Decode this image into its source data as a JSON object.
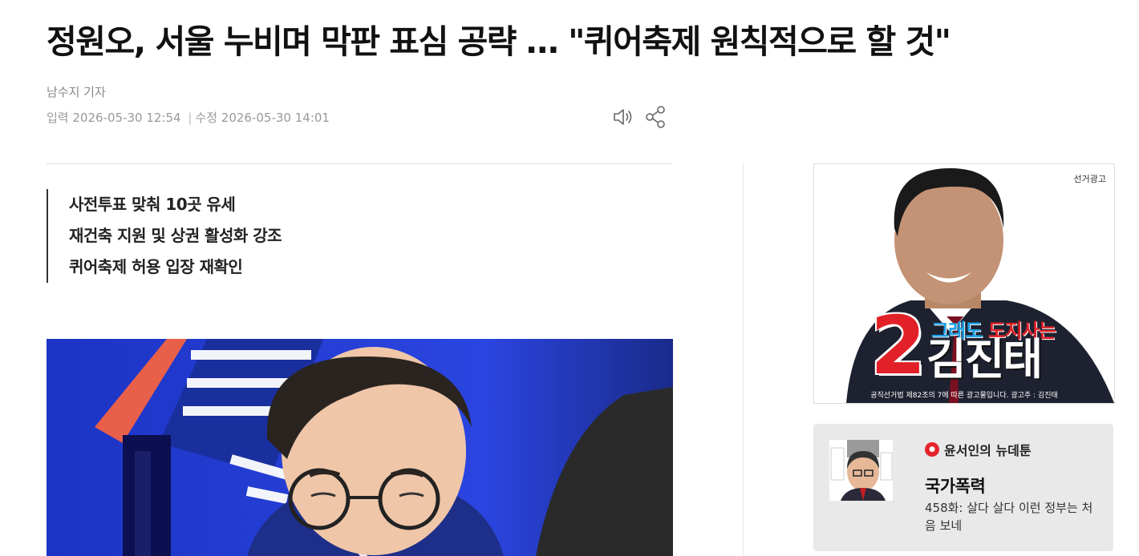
{
  "article": {
    "headline": "정원오, 서울 누비며 막판 표심 공략 … \"퀴어축제 원칙적으로 할 것\"",
    "reporter": "남수지 기자",
    "input_label": "입력",
    "input_date": "2026-05-30 12:54",
    "separator": "|",
    "update_label": "수정",
    "update_date": "2026-05-30 14:01",
    "subheadings": [
      "사전투표 맞춰 10곳 유세",
      "재건축 지원 및 상권 활성화 강조",
      "퀴어축제 허용 입장 재확인"
    ]
  },
  "tools": {
    "tts_icon": "speaker-icon",
    "share_icon": "share-icon"
  },
  "ad": {
    "label": "선거광고",
    "number": "2",
    "slogan_part1": "그래도",
    "slogan_part2": "도지사는",
    "name": "김진태",
    "footer": "공직선거법 제82조의 7에 따른 광고물입니다. 광고주 : 김진태",
    "colors": {
      "number": "#e12127",
      "slogan_blue": "#1aa0e8",
      "background_blue": "#1f35c8"
    }
  },
  "webtoon": {
    "brand": "윤서인의 뉴데툰",
    "title": "국가폭력",
    "description": "458화: 살다 살다 이런 정부는 처음 보네"
  }
}
